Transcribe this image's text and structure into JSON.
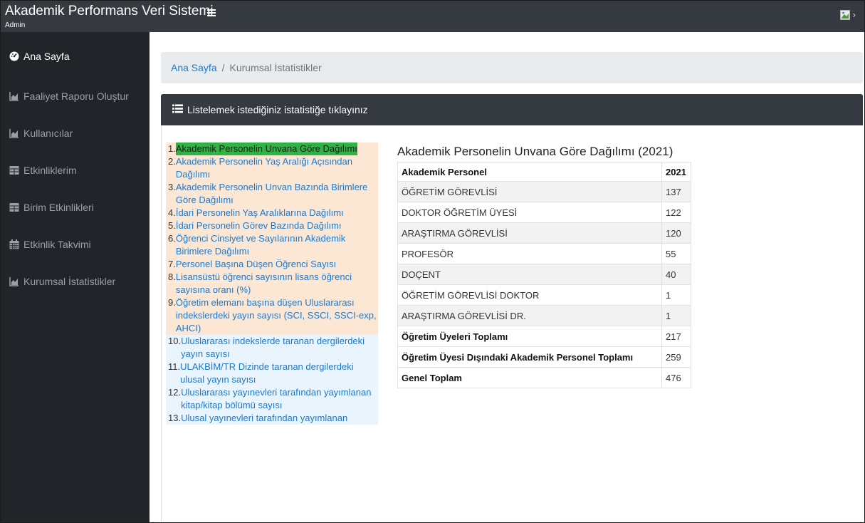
{
  "app": {
    "title": "Akademik Performans Veri Sistemi",
    "user": "Admin"
  },
  "sidebar": {
    "items": [
      {
        "label": "Ana Sayfa",
        "icon": "dashboard-icon"
      },
      {
        "label": "Faaliyet Raporu Oluştur",
        "icon": "area-chart-icon"
      },
      {
        "label": "Kullanıcılar",
        "icon": "area-chart-icon"
      },
      {
        "label": "Etkinliklerim",
        "icon": "table-icon"
      },
      {
        "label": "Birim Etkinlikleri",
        "icon": "table-icon"
      },
      {
        "label": "Etkinlik Takvimi",
        "icon": "calendar-icon"
      },
      {
        "label": "Kurumsal İstatistikler",
        "icon": "area-chart-icon"
      }
    ]
  },
  "breadcrumb": {
    "home": "Ana Sayfa",
    "separator": "/",
    "current": "Kurumsal İstatistikler"
  },
  "card": {
    "header": "Listelemek istediğiniz istatistiğe tıklayınız"
  },
  "stats_list": [
    {
      "num": "1.",
      "text": "Akademik Personelin Unvana Göre Dağılımı"
    },
    {
      "num": "2.",
      "text": "Akademik Personelin Yaş Aralığı Açısından Dağılımı"
    },
    {
      "num": "3.",
      "text": "Akademik Personelin Unvan Bazında Birimlere Göre Dağılımı"
    },
    {
      "num": "4.",
      "text": "İdari Personelin Yaş Aralıklarına Dağılımı"
    },
    {
      "num": "5.",
      "text": "İdari Personelin Görev Bazında Dağılımı"
    },
    {
      "num": "6.",
      "text": "Öğrenci Cinsiyet ve Sayılarının Akademik Birimlere Dağılımı"
    },
    {
      "num": "7.",
      "text": "Personel Başına Düşen Öğrenci Sayısı"
    },
    {
      "num": "8.",
      "text": "Lisansüstü öğrenci sayısının lisans öğrenci sayısına oranı (%)"
    },
    {
      "num": "9.",
      "text": "Öğretim elemanı başına düşen Uluslararası indekslerdeki yayın sayısı (SCI, SSCI, SSCI-exp, AHCI)"
    },
    {
      "num": "10.",
      "text": "Uluslararası indekslerde taranan dergilerdeki yayın sayısı"
    },
    {
      "num": "11.",
      "text": "ULAKBİM/TR Dizinde taranan dergilerdeki ulusal yayın sayısı"
    },
    {
      "num": "12.",
      "text": "Uluslararası yayınevleri tarafından yayımlanan kitap/kitap bölümü sayısı"
    },
    {
      "num": "13.",
      "text": "Ulusal yayınevleri tarafından yayımlanan"
    }
  ],
  "table": {
    "title": "Akademik Personelin Unvana Göre Dağılımı (2021)",
    "headers": [
      "Akademik Personel",
      "2021"
    ],
    "rows": [
      [
        "ÖĞRETİM GÖREVLİSİ",
        "137"
      ],
      [
        "DOKTOR ÖĞRETİM ÜYESİ",
        "122"
      ],
      [
        "ARAŞTIRMA GÖREVLİSİ",
        "120"
      ],
      [
        "PROFESÖR",
        "55"
      ],
      [
        "DOÇENT",
        "40"
      ],
      [
        "ÖĞRETİM GÖREVLİSİ DOKTOR",
        "1"
      ],
      [
        "ARAŞTIRMA GÖREVLİSİ DR.",
        "1"
      ],
      [
        "Öğretim Üyeleri Toplamı",
        "217"
      ],
      [
        "Öğretim Üyesi Dışındaki Akademik Personel Toplamı",
        "259"
      ],
      [
        "Genel Toplam",
        "476"
      ]
    ]
  },
  "colors": {
    "navbar": "#343a40",
    "sidebar": "#212529",
    "link": "#1f78c8",
    "selected": "#2fb344",
    "list_peach": "#fce7d4",
    "list_blue": "#e9f4fc"
  }
}
